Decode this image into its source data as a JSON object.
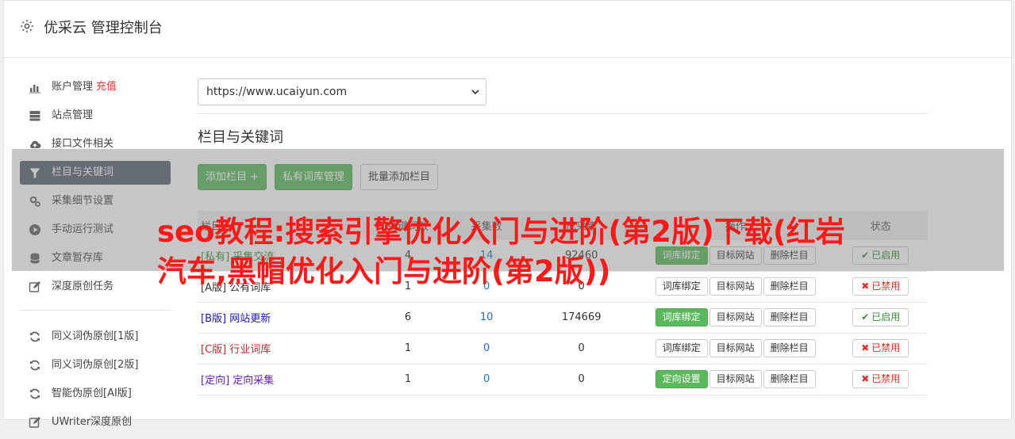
{
  "header": {
    "title": "优采云 管理控制台"
  },
  "sidebar": {
    "items": [
      {
        "label": "账户管理",
        "extra": "充值",
        "icon": "bar-chart-icon"
      },
      {
        "label": "站点管理",
        "icon": "server-icon"
      },
      {
        "label": "接口文件相关",
        "icon": "cloud-upload-icon"
      },
      {
        "label": "栏目与关键词",
        "icon": "filter-icon",
        "active": true
      },
      {
        "label": "采集细节设置",
        "icon": "cogs-icon"
      },
      {
        "label": "手动运行测试",
        "icon": "play-circle-icon"
      },
      {
        "label": "文章暂存库",
        "icon": "database-icon"
      },
      {
        "label": "深度原创任务",
        "icon": "edit-icon"
      }
    ],
    "items2": [
      {
        "label": "同义词伪原创[1版]",
        "icon": "refresh-icon"
      },
      {
        "label": "同义词伪原创[2版]",
        "icon": "refresh-icon"
      },
      {
        "label": "智能伪原创[AI版]",
        "icon": "refresh-icon"
      },
      {
        "label": "UWriter深度原创",
        "icon": "edit-icon"
      }
    ]
  },
  "main": {
    "site_url": "https://www.ucaiyun.com",
    "section_title": "栏目与关键词",
    "buttons": {
      "add_column": "添加栏目 +",
      "private_lib": "私有词库管理",
      "batch_add": "批量添加栏目"
    },
    "table": {
      "headers": [
        "栏目",
        "关键词数",
        "采集数",
        "已采集",
        "操作",
        "状态"
      ],
      "rows": [
        {
          "tag": "[私有]",
          "name": "采集交流",
          "kw": "4",
          "collect": "14",
          "done": "92460",
          "op1": "词库绑定",
          "op2": "目标网站",
          "op3": "删除栏目",
          "status": "已启用",
          "enabled": true,
          "color": "#3c8a3c"
        },
        {
          "tag": "[A版]",
          "name": "公有词库",
          "kw": "1",
          "collect": "0",
          "done": "0",
          "op1": "词库绑定",
          "op2": "目标网站",
          "op3": "删除栏目",
          "status": "已禁用",
          "enabled": false,
          "color": "#333333"
        },
        {
          "tag": "[B版]",
          "name": "网站更新",
          "kw": "6",
          "collect": "10",
          "done": "174669",
          "op1": "词库绑定",
          "op2": "目标网站",
          "op3": "删除栏目",
          "status": "已启用",
          "enabled": true,
          "color": "#1a1aa8"
        },
        {
          "tag": "[C版]",
          "name": "行业词库",
          "kw": "1",
          "collect": "0",
          "done": "0",
          "op1": "词库绑定",
          "op2": "目标网站",
          "op3": "删除栏目",
          "status": "已禁用",
          "enabled": false,
          "color": "#a83232"
        },
        {
          "tag": "[定向]",
          "name": "定向采集",
          "kw": "1",
          "collect": "0",
          "done": "0",
          "op1": "定向设置",
          "op2": "目标网站",
          "op3": "删除栏目",
          "status": "已禁用",
          "enabled": false,
          "color": "#6a1fa8"
        }
      ]
    }
  },
  "overlay": {
    "text": "seo教程:搜索引擎优化入门与进阶(第2版)下载(红岩汽车,黑帽优化入门与进阶(第2版))"
  },
  "colors": {
    "green": "#5cb85c",
    "active_nav": "#5b6472",
    "enabled_green": "#3c8a3c",
    "disabled_red": "#d9302c",
    "link_blue": "#2a6ebb",
    "overlay_red": "#ff1a1a"
  }
}
